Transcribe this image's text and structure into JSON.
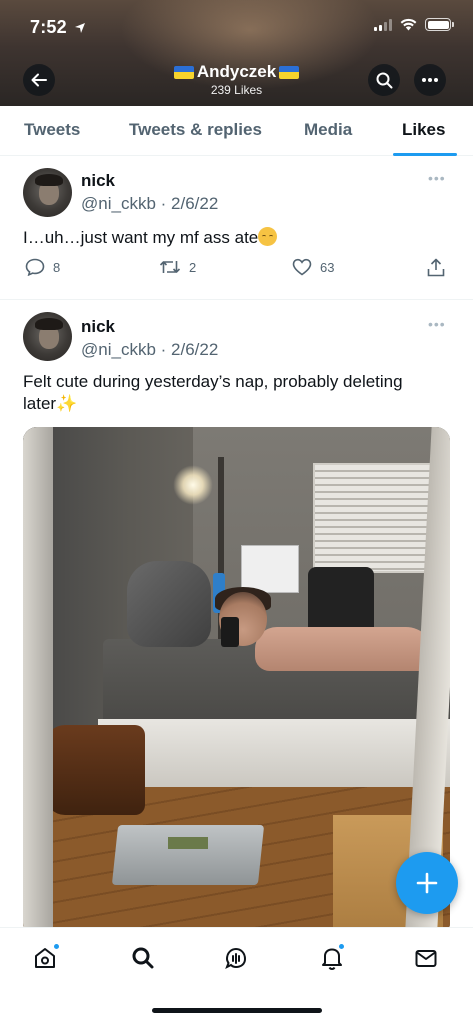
{
  "status_bar": {
    "time": "7:52"
  },
  "header": {
    "name": "Andyczek",
    "likes_count": "239 Likes",
    "banner_color": "#3e3430"
  },
  "tabs": [
    {
      "label": "Tweets",
      "active": false
    },
    {
      "label": "Tweets & replies",
      "active": false
    },
    {
      "label": "Media",
      "active": false
    },
    {
      "label": "Likes",
      "active": true
    }
  ],
  "tweets": [
    {
      "display_name": "nick",
      "handle": "@ni_ckkb",
      "separator": "·",
      "date": "2/6/22",
      "text": "I…uh…just want my mf ass ate",
      "replies": "8",
      "retweets": "2",
      "likes": "63"
    },
    {
      "display_name": "nick",
      "handle": "@ni_ckkb",
      "separator": "·",
      "date": "2/6/22",
      "text": "Felt cute during yesterday’s nap, probably deleting later",
      "has_photo": true
    }
  ],
  "colors": {
    "accent": "#1d9bf0",
    "text_primary": "#0f1419",
    "text_secondary": "#536471"
  },
  "nav": {
    "items": [
      "home-icon",
      "search-icon",
      "spaces-icon",
      "notifications-icon",
      "messages-icon"
    ]
  }
}
